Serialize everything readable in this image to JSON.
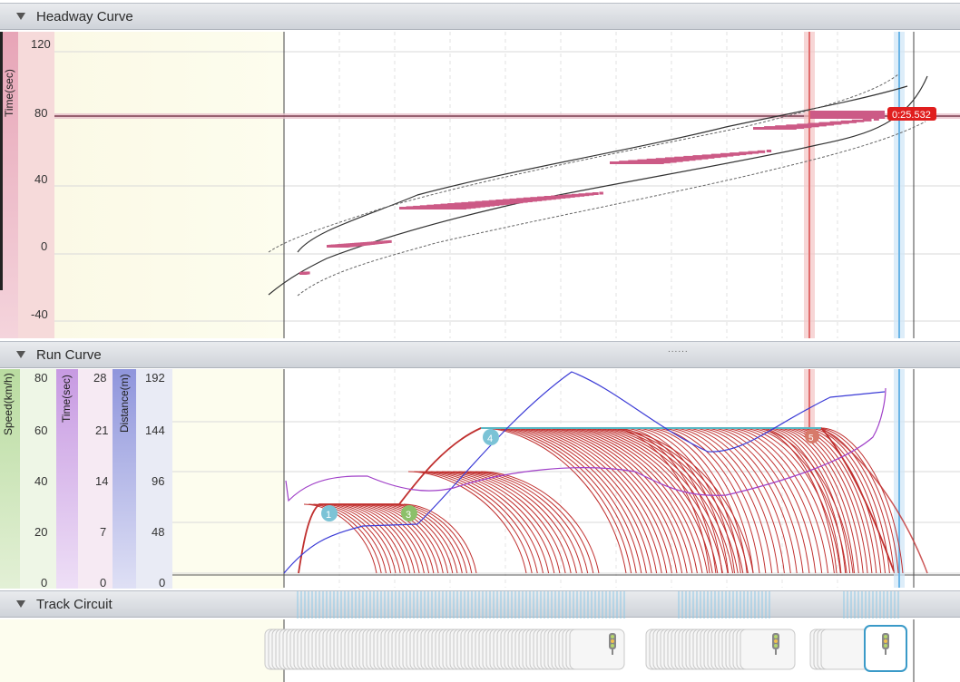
{
  "headway": {
    "title": "Headway Curve",
    "axis_label": "Time(sec)",
    "ticks": [
      "120",
      "80",
      "40",
      "0",
      "-40"
    ],
    "marker_time": "0:25.532"
  },
  "run": {
    "title": "Run Curve",
    "speed_label": "Speed(km/h)",
    "time_label": "Time(sec)",
    "distance_label": "Distance(m)",
    "speed_ticks": [
      "80",
      "60",
      "40",
      "20",
      "0"
    ],
    "time_ticks": [
      "28",
      "21",
      "14",
      "7",
      "0"
    ],
    "distance_ticks": [
      "192",
      "144",
      "96",
      "48",
      "0"
    ],
    "markers": [
      "1",
      "3",
      "4",
      "5"
    ],
    "splitter": "......"
  },
  "track": {
    "title": "Track Circuit"
  },
  "colors": {
    "headway_bar": "#cc5a86",
    "speed_curve": "#c0302f",
    "distance_curve": "#3b3bd6",
    "time_curve": "#a040c8",
    "red_marker_line": "#e06c6c",
    "blue_marker_line": "#6ab4e6"
  },
  "icons": [
    "triangle-collapse-icon",
    "traffic-signal-icon"
  ]
}
